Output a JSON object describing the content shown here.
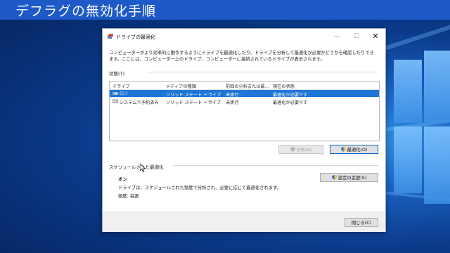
{
  "banner": {
    "title": "デフラグの無効化手順"
  },
  "window": {
    "title": "ドライブの最適化",
    "description": "コンピューターがより効率的に動作するようにドライブを最適化したり、ドライブを分析して最適化が必要かどうかを確認したりできます。ここには、コンピューター上のドライブ、コンピューターに接続されているドライブが表示されます。",
    "status_label": "状態(T)",
    "columns": [
      "ドライブ",
      "メディアの種類",
      "前回の分析または最...",
      "現在の状態"
    ],
    "drives": [
      {
        "name": "(C:)",
        "media": "ソリッド ステート ドライブ",
        "last": "未実行",
        "status": "最適化が必要です",
        "selected": true,
        "icon": "drive-c-icon"
      },
      {
        "name": "システムで予約済み",
        "media": "ソリッド ステート ドライブ",
        "last": "未実行",
        "status": "最適化が必要です",
        "selected": false,
        "icon": "drive-icon"
      }
    ],
    "analyze_button": "分析(A)",
    "optimize_button": "最適化(O)",
    "scheduled_label": "スケジュールされた最適化",
    "schedule_state": "オン",
    "schedule_desc": "ドライブは、スケジュールされた頻度で分析され、必要に応じて最適化されます。",
    "schedule_freq": "頻度: 毎週",
    "change_settings_button": "設定の変更(S)",
    "close_button": "閉じる(C)"
  },
  "colors": {
    "selection": "#1e76d7",
    "banner": "#1d59c7"
  }
}
